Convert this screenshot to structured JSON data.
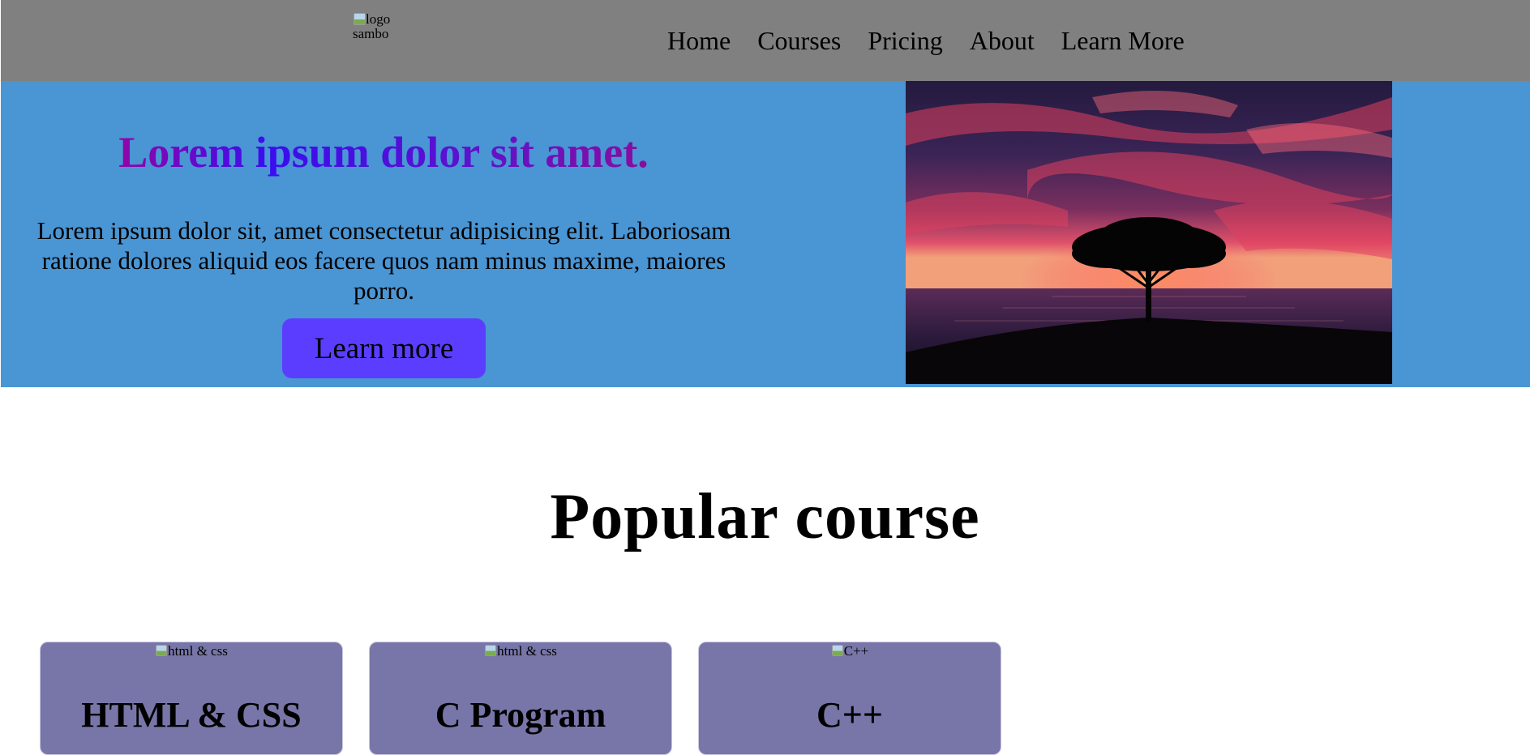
{
  "header": {
    "logo_alt": "logo sambo",
    "nav": [
      {
        "label": "Home"
      },
      {
        "label": "Courses"
      },
      {
        "label": "Pricing"
      },
      {
        "label": "About"
      },
      {
        "label": "Learn More"
      }
    ],
    "background": "#808080"
  },
  "hero": {
    "title": "Lorem ipsum dolor sit amet.",
    "text": "Lorem ipsum dolor sit, amet consectetur adipisicing elit. Laboriosam ratione dolores aliquid eos facere quos nam minus maxime, maiores porro.",
    "button_label": "Learn more",
    "background": "#4a95d4",
    "button_color": "#5b3dff",
    "image": "sunset tree silhouette over sea"
  },
  "courses": {
    "title": "Popular course",
    "cards": [
      {
        "image_alt": "html & css",
        "title": "HTML & CSS"
      },
      {
        "image_alt": "html & css",
        "title": "C Program"
      },
      {
        "image_alt": "C++",
        "title": "C++"
      }
    ],
    "card_color": "#7876a8"
  }
}
